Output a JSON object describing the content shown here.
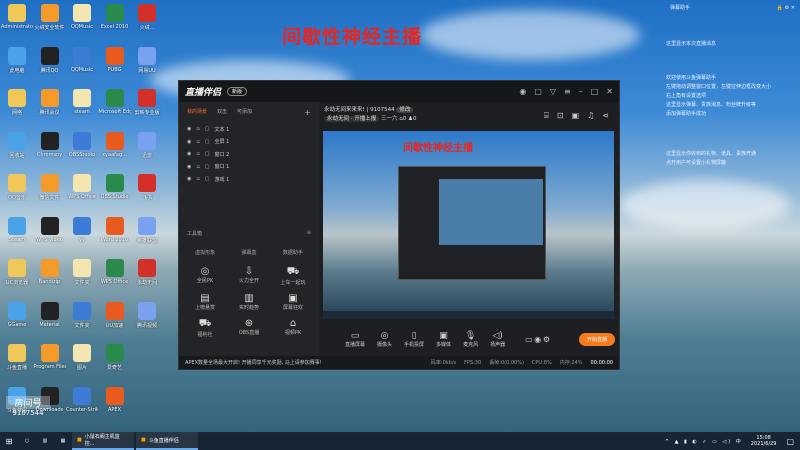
{
  "desktop": {
    "headline": "间歇性神经主播",
    "icons": [
      [
        "Administrator",
        "火绒安全软件",
        "QQMusic",
        "Excel 2010",
        "火绒..."
      ],
      [
        "此电脑",
        "腾讯QQ",
        "QQMusic",
        "PUBG",
        "网易UU"
      ],
      [
        "网络",
        "腾讯会议",
        "steam",
        "Microsoft Edge",
        "剪映专业版"
      ],
      [
        "回收站",
        "Chromsoy",
        "OBSStudio",
        "xyaafag...",
        "迅雷"
      ],
      [
        "QQ音乐",
        "微信文件",
        "WPS Office",
        "OBS Studio",
        "飞书"
      ],
      [
        "Steam",
        "WPS Video",
        "yy",
        "Word 2010",
        "英雄联盟"
      ],
      [
        "UC浏览器",
        "Bandizip",
        "文件夹",
        "WPS Office",
        "永劫无间"
      ],
      [
        "GGame",
        "Material",
        "文件夹",
        "UU加速",
        "腾讯视频"
      ],
      [
        "斗鱼直播",
        "Program Files",
        "图片",
        "爱奇艺",
        ""
      ],
      [
        "斗鱼伴侣",
        "Downloads",
        "Counter-Strike Global Offensive",
        "APEX",
        ""
      ]
    ],
    "room_watermark": "房间号",
    "room_id": "9107544"
  },
  "notices": {
    "header": "弹幕助手",
    "line0": "这里显示本次直播消息",
    "lines1": [
      "欢迎使用斗鱼弹幕助手",
      "左键拖动调整窗口位置，左键拉伸边框改变大小",
      "右上角有设置选项",
      "这里显示弹幕、贵族消息、粉丝牌升级等",
      "添加弹幕助手成功"
    ],
    "lines2": [
      "这里显示你收到的礼物、道具、贵族开通",
      "点开用户可设置小礼物屏蔽"
    ]
  },
  "app": {
    "title": "直播伴侣",
    "badge": "新版",
    "tabs": [
      "我的场景",
      "双击",
      "可添加"
    ],
    "layers": [
      "文本 1",
      "全屏 1",
      "窗口 2",
      "窗口 1",
      "游戏 1"
    ],
    "room_title": "永劫无间来来来!",
    "room_id": "9107544",
    "edit": "修改",
    "category": "永劫无间 · 开播上报",
    "channel": "三一六",
    "hot": "0",
    "fans": "0",
    "toolbox": "工具箱",
    "tool_tabs": [
      "虚拟形象",
      "弹幕盒",
      "数据助手"
    ],
    "tools": [
      [
        "全民PK",
        "火力全开",
        "上车一起玩"
      ],
      [
        "上榜悬赏",
        "实时趋势",
        "屏幕狂欢"
      ],
      [
        "福利社",
        "OBS直播",
        "视频PK"
      ]
    ],
    "bottom": [
      "直播屏幕",
      "摄像头",
      "手机投屏",
      "多媒体",
      "麦克风",
      "扬声器"
    ],
    "live_button": "开始直播",
    "status": {
      "notice": "APEX数量全场最大开启! 开播同享千元奖励, 马上请参加赛事!",
      "rate": "码率:0kb/s",
      "fps": "FPS:30",
      "lost": "丢帧:0(0.00%)",
      "cpu": "CPU:8%",
      "mem": "内存:24%",
      "time": "00:00:00"
    },
    "preview_headline": "间歇性神经主播"
  },
  "taskbar": {
    "tasks": [
      "小鼠石阁主机监控...",
      "斗鱼直播伴侣"
    ],
    "time": "15:08",
    "date": "2021/6/29"
  }
}
